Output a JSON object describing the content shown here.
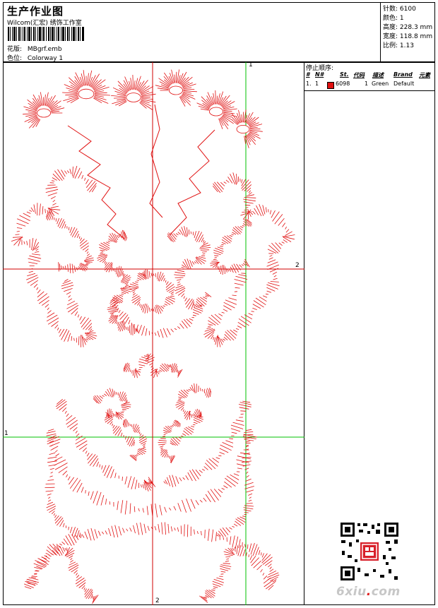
{
  "header": {
    "title": "生产作业图",
    "company": "Wilcom(汇宏) 绣饰工作室",
    "design_label": "花版:",
    "design_value": "MBgrf.emb",
    "colorway_label": "色位:",
    "colorway_value": "Colorway 1"
  },
  "stats": [
    {
      "label": "针数:",
      "value": "6100"
    },
    {
      "label": "颜色:",
      "value": "1"
    },
    {
      "label": "高度:",
      "value": "228.3 mm"
    },
    {
      "label": "宽度:",
      "value": "118.8 mm"
    },
    {
      "label": "比例:",
      "value": "1.13"
    }
  ],
  "stop_sequence": {
    "title": "停止顺序:",
    "columns": [
      "#",
      "N#",
      "St.",
      "代码",
      "描述",
      "Brand",
      "元素"
    ],
    "rows": [
      {
        "num": "1.",
        "n": "1",
        "color": "#e01010",
        "st": "6098",
        "code": "1",
        "desc": "Green",
        "brand": "Default",
        "elem": ""
      }
    ]
  },
  "axes": {
    "top_label": "1",
    "right_label": "2",
    "left_label": "1",
    "bottom_label": "2"
  },
  "watermark": {
    "text_main": "6xiu",
    "text_dot": ".",
    "text_tail": "com"
  },
  "colors": {
    "stitch": "#e01010",
    "guide_green": "#00c000",
    "guide_red": "#d00000"
  }
}
